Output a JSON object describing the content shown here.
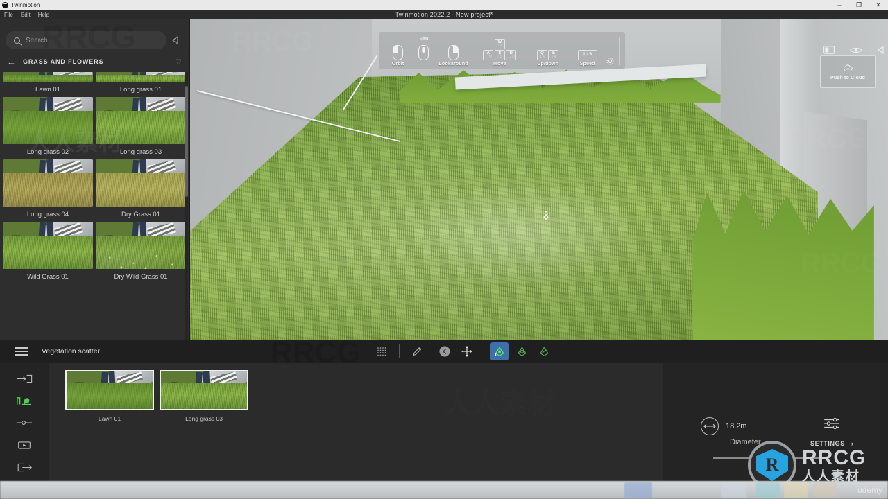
{
  "os": {
    "taskbar_title": "Twinmotion",
    "window_controls": {
      "minimize": "–",
      "maximize": "❐",
      "close": "✕"
    }
  },
  "app": {
    "title": "Twinmotion 2022.2 - New project*",
    "menu": [
      {
        "label": "File"
      },
      {
        "label": "Edit"
      },
      {
        "label": "Help"
      }
    ]
  },
  "library": {
    "search": {
      "placeholder": "Search",
      "value": "",
      "icon": "search-icon"
    },
    "collapse_icon": "chevron-left-icon",
    "back_icon": "arrow-left-icon",
    "category": "GRASS AND FLOWERS",
    "favorite_icon": "heart-icon",
    "items": [
      {
        "label": "Lawn 01",
        "variant": "v-flat",
        "clipped": true
      },
      {
        "label": "Long grass 01",
        "variant": "v-long",
        "clipped": true
      },
      {
        "label": "Long grass 02",
        "variant": "v-flat",
        "clipped": false
      },
      {
        "label": "Long grass 03",
        "variant": "v-long",
        "clipped": false
      },
      {
        "label": "Long grass 04",
        "variant": "v-dry",
        "clipped": false
      },
      {
        "label": "Dry Grass 01",
        "variant": "v-dry2",
        "clipped": false
      },
      {
        "label": "Wild Grass 01",
        "variant": "v-long",
        "clipped": false
      },
      {
        "label": "Dry Wild Grass 01",
        "variant": "v-wild",
        "clipped": false
      }
    ]
  },
  "viewport": {
    "nav_help": {
      "orbit": {
        "label": "Orbit",
        "icon": "mouse-left-icon"
      },
      "pan": {
        "label": "Lookaround",
        "top_label": "Pan",
        "icon_pan": "mouse-middle-icon",
        "icon_look": "mouse-right-icon"
      },
      "move": {
        "label": "Move",
        "keys": [
          {
            "main": "W",
            "sub": "↑ Z"
          },
          {
            "main": "A",
            "sub": "← Q"
          },
          {
            "main": "S",
            "sub": "↓ S"
          },
          {
            "main": "D",
            "sub": "→ D"
          }
        ]
      },
      "updown": {
        "label": "Up/down",
        "keys": [
          {
            "main": "Q",
            "sub": "1 4"
          },
          {
            "main": "E",
            "sub": "1 4"
          }
        ]
      },
      "speed": {
        "label": "Speed",
        "key": "1 - 6"
      },
      "settings_icon": "gear-icon"
    },
    "push_to_cloud": {
      "label": "Push to Cloud",
      "icon": "cloud-upload-icon"
    },
    "top_right_icons": [
      {
        "name": "panel-layout-icon"
      },
      {
        "name": "eye-icon"
      },
      {
        "name": "chevron-left-icon"
      }
    ],
    "brush_cursor": "scatter-brush-cursor"
  },
  "bottom_panel": {
    "menu_icon": "hamburger-icon",
    "title": "Vegetation scatter",
    "tools": [
      {
        "name": "scatter-grid-icon",
        "active": false
      },
      {
        "name": "eyedropper-icon",
        "active": false
      },
      {
        "name": "undo-icon",
        "active": false
      },
      {
        "name": "move-icon",
        "active": false
      },
      {
        "name": "paint-add-icon",
        "active": true
      },
      {
        "name": "paint-modify-icon",
        "active": false
      },
      {
        "name": "paint-erase-icon",
        "active": false
      }
    ],
    "side_tools": [
      {
        "name": "import-icon",
        "active": false
      },
      {
        "name": "vegetation-icon",
        "active": true
      },
      {
        "name": "path-icon",
        "active": false
      },
      {
        "name": "media-icon",
        "active": false
      },
      {
        "name": "export-icon",
        "active": false
      }
    ],
    "assets": [
      {
        "label": "Lawn 01",
        "variant": "v-flat"
      },
      {
        "label": "Long grass 03",
        "variant": "v-long"
      }
    ],
    "diameter": {
      "label": "Diameter",
      "value": "18.2m",
      "icon": "diameter-icon",
      "slider_pct": 62
    },
    "settings": {
      "label": "SETTINGS",
      "icon": "sliders-icon",
      "chevron": "›"
    }
  },
  "watermarks": {
    "brand": "RRCG",
    "brand_cn": "人人素材",
    "platform": "udemy"
  },
  "colors": {
    "accent_blue": "#3d6fa8",
    "accent_green": "#4dd24d",
    "panel_bg": "#242424",
    "library_bg": "#2e2e2e",
    "logo_blue": "#29a3e0"
  }
}
